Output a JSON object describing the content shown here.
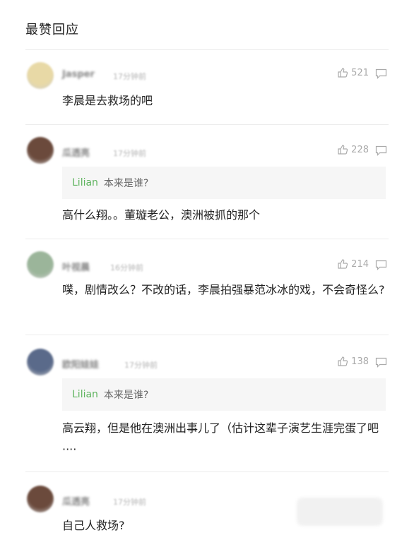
{
  "header": {
    "title": "最赞回应"
  },
  "comments": [
    {
      "avatar_color": "#e8d9a6",
      "name": "Jasper",
      "time": "17分钟前",
      "likes": "521",
      "text": "李晨是去救场的吧"
    },
    {
      "avatar_color": "#6b4a3c",
      "name": "瓜透亮",
      "time": "17分钟前",
      "likes": "228",
      "quote": {
        "name": "Lilian",
        "text": "本来是谁?"
      },
      "text": "高什么翔。。董璇老公，澳洲被抓的那个"
    },
    {
      "avatar_color": "#9bb59a",
      "name": "叶视晨",
      "time": "16分钟前",
      "likes": "214",
      "text": "噗，剧情改么？不改的话，李晨拍强暴范冰冰的戏，不会奇怪么?"
    },
    {
      "avatar_color": "#5a6a8a",
      "name": "欧阳娃娃",
      "time": "17分钟前",
      "likes": "138",
      "quote": {
        "name": "Lilian",
        "text": "本来是谁?"
      },
      "text": "高云翔，但是他在澳洲出事儿了（估计这辈子演艺生涯完蛋了吧····"
    },
    {
      "avatar_color": "#6b4a3c",
      "name": "瓜透亮",
      "time": "17分钟前",
      "text": "自己人救场?"
    }
  ]
}
